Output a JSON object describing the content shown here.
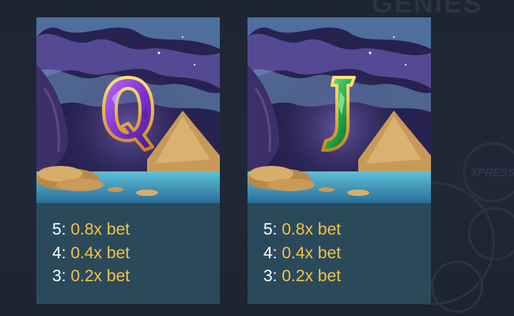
{
  "paytable": [
    {
      "symbol": "Q",
      "symbol_color": "#7a2fcf",
      "symbol_icon": "queen-gem-letter-icon",
      "payouts": [
        {
          "count": "5:",
          "multiplier": "0.8x bet"
        },
        {
          "count": "4:",
          "multiplier": "0.4x bet"
        },
        {
          "count": "3:",
          "multiplier": "0.2x bet"
        }
      ]
    },
    {
      "symbol": "J",
      "symbol_color": "#1fa84a",
      "symbol_icon": "jack-gem-letter-icon",
      "payouts": [
        {
          "count": "5:",
          "multiplier": "0.8x bet"
        },
        {
          "count": "4:",
          "multiplier": "0.4x bet"
        },
        {
          "count": "3:",
          "multiplier": "0.2x bet"
        }
      ]
    }
  ],
  "colors": {
    "card_background": "#2a4a5c",
    "multiplier_text": "#f5c242",
    "count_text": "#ffffff",
    "backdrop": "#1d2532"
  }
}
